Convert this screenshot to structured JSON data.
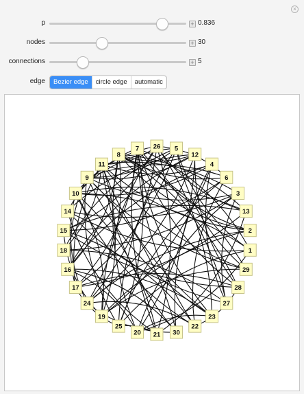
{
  "controls": {
    "p": {
      "label": "p",
      "value": "0.836",
      "fraction": 0.82
    },
    "nodes": {
      "label": "nodes",
      "value": "30",
      "fraction": 0.38
    },
    "connections": {
      "label": "connections",
      "value": "5",
      "fraction": 0.24
    },
    "edge": {
      "label": "edge",
      "options": [
        "Bezier edge",
        "circle edge",
        "automatic"
      ],
      "selected": "Bezier edge"
    }
  },
  "graph": {
    "node_order_clockwise_from_top": [
      "26",
      "5",
      "12",
      "4",
      "6",
      "3",
      "13",
      "2",
      "1",
      "29",
      "28",
      "27",
      "23",
      "22",
      "30",
      "21",
      "20",
      "25",
      "19",
      "24",
      "17",
      "16",
      "18",
      "15",
      "14",
      "10",
      "9",
      "11",
      "8",
      "7"
    ],
    "colors": {
      "node_fill": "#fffdc4",
      "node_stroke": "#c7c48a",
      "edge": "#111111"
    },
    "edges": [
      [
        "26",
        "21"
      ],
      [
        "26",
        "19"
      ],
      [
        "26",
        "24"
      ],
      [
        "26",
        "13"
      ],
      [
        "26",
        "6"
      ],
      [
        "26",
        "10"
      ],
      [
        "26",
        "23"
      ],
      [
        "5",
        "25"
      ],
      [
        "5",
        "17"
      ],
      [
        "5",
        "1"
      ],
      [
        "5",
        "9"
      ],
      [
        "5",
        "29"
      ],
      [
        "12",
        "20"
      ],
      [
        "12",
        "14"
      ],
      [
        "12",
        "24"
      ],
      [
        "12",
        "28"
      ],
      [
        "12",
        "8"
      ],
      [
        "4",
        "16"
      ],
      [
        "4",
        "19"
      ],
      [
        "4",
        "27"
      ],
      [
        "4",
        "11"
      ],
      [
        "4",
        "30"
      ],
      [
        "6",
        "15"
      ],
      [
        "6",
        "25"
      ],
      [
        "6",
        "8"
      ],
      [
        "6",
        "22"
      ],
      [
        "3",
        "18"
      ],
      [
        "3",
        "20"
      ],
      [
        "3",
        "9"
      ],
      [
        "3",
        "27"
      ],
      [
        "13",
        "17"
      ],
      [
        "13",
        "8"
      ],
      [
        "13",
        "21"
      ],
      [
        "13",
        "10"
      ],
      [
        "2",
        "7"
      ],
      [
        "2",
        "24"
      ],
      [
        "2",
        "11"
      ],
      [
        "2",
        "19"
      ],
      [
        "1",
        "14"
      ],
      [
        "1",
        "10"
      ],
      [
        "1",
        "20"
      ],
      [
        "1",
        "25"
      ],
      [
        "29",
        "9"
      ],
      [
        "29",
        "19"
      ],
      [
        "29",
        "11"
      ],
      [
        "28",
        "8"
      ],
      [
        "28",
        "15"
      ],
      [
        "28",
        "17"
      ],
      [
        "28",
        "22"
      ],
      [
        "27",
        "7"
      ],
      [
        "27",
        "14"
      ],
      [
        "27",
        "18"
      ],
      [
        "23",
        "9"
      ],
      [
        "23",
        "16"
      ],
      [
        "23",
        "11"
      ],
      [
        "23",
        "20"
      ],
      [
        "22",
        "7"
      ],
      [
        "22",
        "15"
      ],
      [
        "22",
        "10"
      ],
      [
        "22",
        "24"
      ],
      [
        "30",
        "11"
      ],
      [
        "30",
        "16"
      ],
      [
        "30",
        "24"
      ],
      [
        "30",
        "9"
      ],
      [
        "21",
        "7"
      ],
      [
        "21",
        "10"
      ],
      [
        "21",
        "14"
      ],
      [
        "21",
        "25"
      ],
      [
        "20",
        "8"
      ],
      [
        "20",
        "16"
      ],
      [
        "25",
        "9"
      ],
      [
        "25",
        "7"
      ],
      [
        "25",
        "17"
      ],
      [
        "19",
        "11"
      ],
      [
        "19",
        "15"
      ],
      [
        "19",
        "10"
      ],
      [
        "24",
        "10"
      ],
      [
        "24",
        "8"
      ],
      [
        "17",
        "9"
      ],
      [
        "17",
        "7"
      ],
      [
        "17",
        "11"
      ],
      [
        "16",
        "8"
      ],
      [
        "16",
        "12"
      ],
      [
        "18",
        "11"
      ],
      [
        "18",
        "5"
      ],
      [
        "15",
        "26"
      ],
      [
        "15",
        "13"
      ],
      [
        "14",
        "3"
      ],
      [
        "14",
        "7"
      ],
      [
        "10",
        "4"
      ],
      [
        "10",
        "5"
      ],
      [
        "9",
        "12"
      ],
      [
        "9",
        "6"
      ],
      [
        "11",
        "26"
      ],
      [
        "11",
        "3"
      ],
      [
        "8",
        "2"
      ],
      [
        "8",
        "29"
      ],
      [
        "7",
        "23"
      ],
      [
        "7",
        "1"
      ],
      [
        "7",
        "28"
      ]
    ]
  }
}
